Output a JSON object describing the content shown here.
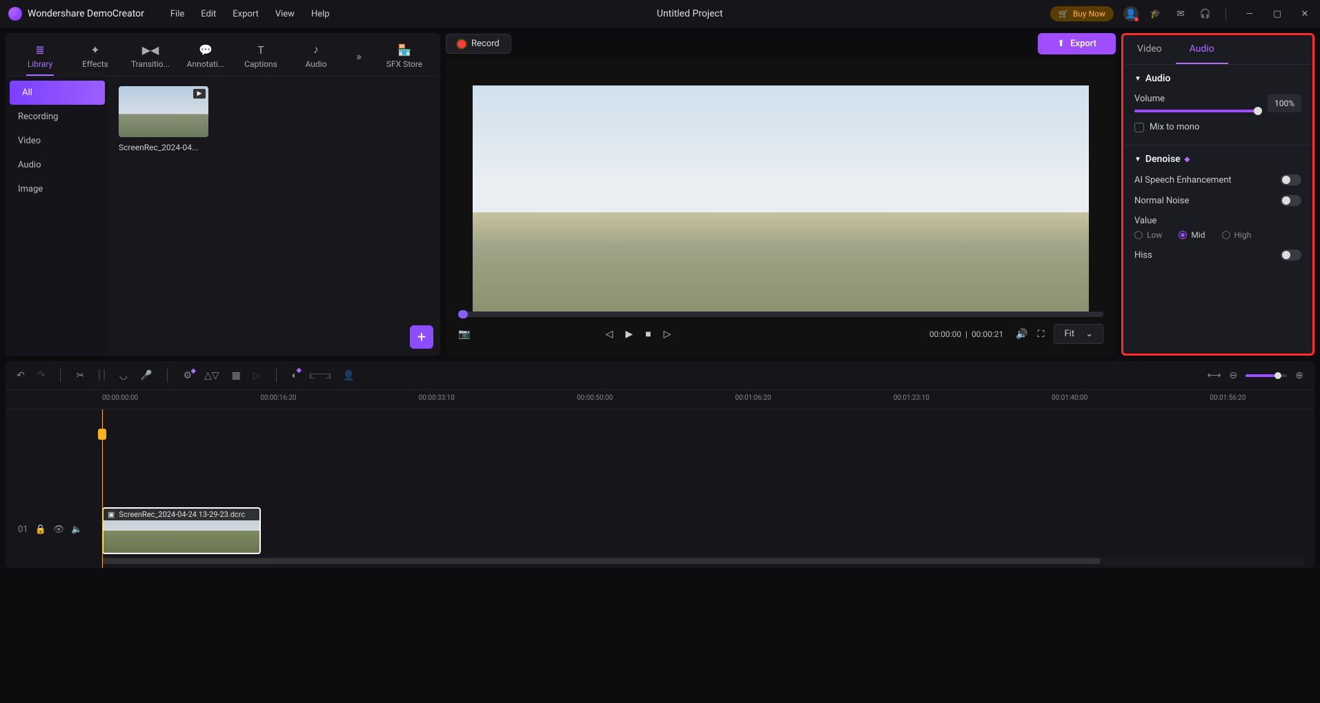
{
  "app": {
    "name": "Wondershare DemoCreator",
    "project": "Untitled Project"
  },
  "menu": [
    "File",
    "Edit",
    "Export",
    "View",
    "Help"
  ],
  "titlebar": {
    "buy": "Buy Now"
  },
  "tabs": [
    "Library",
    "Effects",
    "Transitio...",
    "Annotati...",
    "Captions",
    "Audio"
  ],
  "sfx_tab": "SFX Store",
  "lib_side": [
    "All",
    "Recording",
    "Video",
    "Audio",
    "Image"
  ],
  "thumb": {
    "label": "ScreenRec_2024-04..."
  },
  "record_btn": "Record",
  "export_btn": "Export",
  "preview": {
    "time_cur": "00:00:00",
    "time_total": "00:00:21",
    "fit": "Fit"
  },
  "rp": {
    "tabs": [
      "Video",
      "Audio"
    ],
    "audio_head": "Audio",
    "volume_label": "Volume",
    "volume_val": "100%",
    "mix": "Mix to mono",
    "denoise_head": "Denoise",
    "ai": "AI Speech Enhancement",
    "normal": "Normal Noise",
    "value": "Value",
    "radios": [
      "Low",
      "Mid",
      "High"
    ],
    "hiss": "Hiss"
  },
  "ruler": [
    "00:00:00:00",
    "00:00:16:20",
    "00:00:33:10",
    "00:00:50:00",
    "00:01:06:20",
    "00:01:23:10",
    "00:01:40:00",
    "00:01:56:20"
  ],
  "clip_label": "ScreenRec_2024-04-24 13-29-23.dcrc",
  "track_num": "01"
}
